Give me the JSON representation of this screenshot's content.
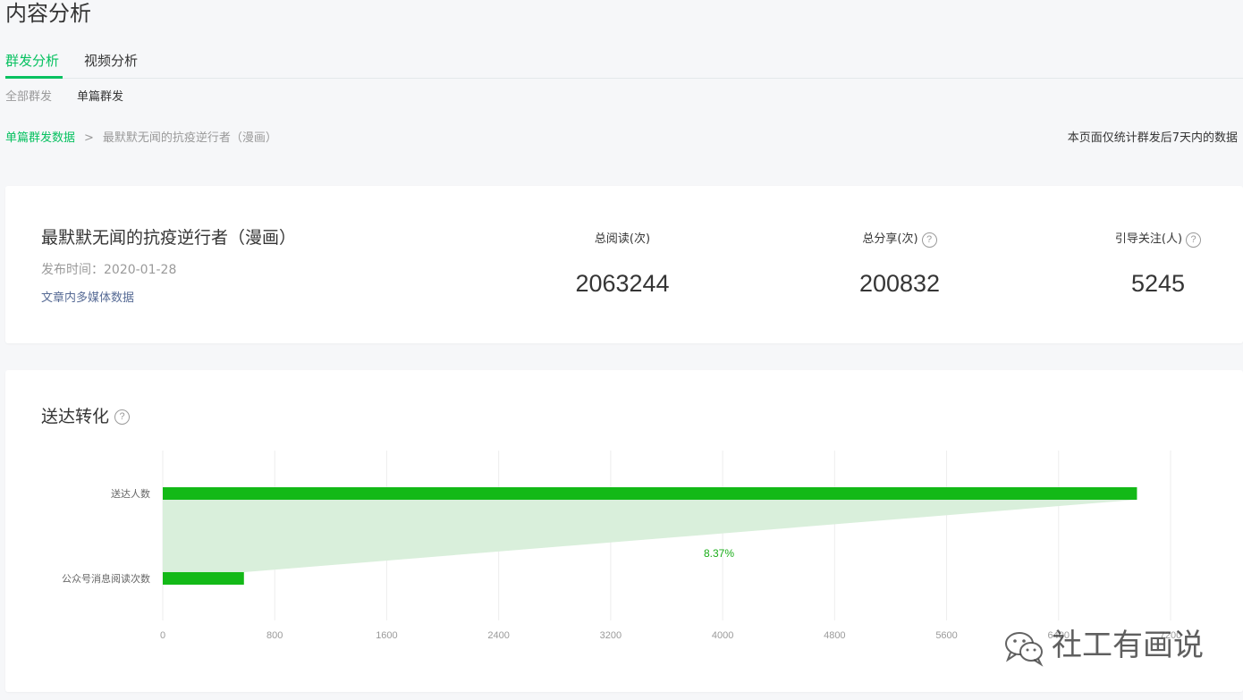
{
  "page": {
    "title": "内容分析"
  },
  "tabs": [
    {
      "label": "群发分析"
    },
    {
      "label": "视频分析"
    }
  ],
  "subtabs": [
    {
      "label": "全部群发"
    },
    {
      "label": "单篇群发"
    }
  ],
  "breadcrumb": {
    "link": "单篇群发数据",
    "separator": ">",
    "current": "最默默无闻的抗疫逆行者（漫画）"
  },
  "note": "本页面仅统计群发后7天内的数据",
  "article": {
    "title": "最默默无闻的抗疫逆行者（漫画）",
    "publish_time": "发布时间：2020-01-28",
    "media_link": "文章内多媒体数据"
  },
  "stats": [
    {
      "label": "总阅读(次)",
      "value": "2063244"
    },
    {
      "label": "总分享(次)",
      "value": "200832"
    },
    {
      "label": "引导关注(人)",
      "value": "5245"
    }
  ],
  "help_icon": "?",
  "section": {
    "title": "送达转化"
  },
  "chart_data": {
    "type": "bar",
    "orientation": "horizontal",
    "categories": [
      "送达人数",
      "公众号消息阅读次数"
    ],
    "values": [
      6960,
      580
    ],
    "conversion_label": "8.37%",
    "xlim": [
      0,
      7200
    ],
    "xticks": [
      "0",
      "800",
      "1600",
      "2400",
      "3200",
      "4000",
      "4800",
      "5600",
      "6400",
      "7200"
    ],
    "grid": true,
    "colors": {
      "bar": "#13b917",
      "funnel": "#d9efdb",
      "label": "#1aad19",
      "grid": "#eeeeee",
      "tick": "#9a9a9a"
    }
  },
  "watermark": {
    "text": "社工有画说",
    "icon": "wechat-icon"
  }
}
